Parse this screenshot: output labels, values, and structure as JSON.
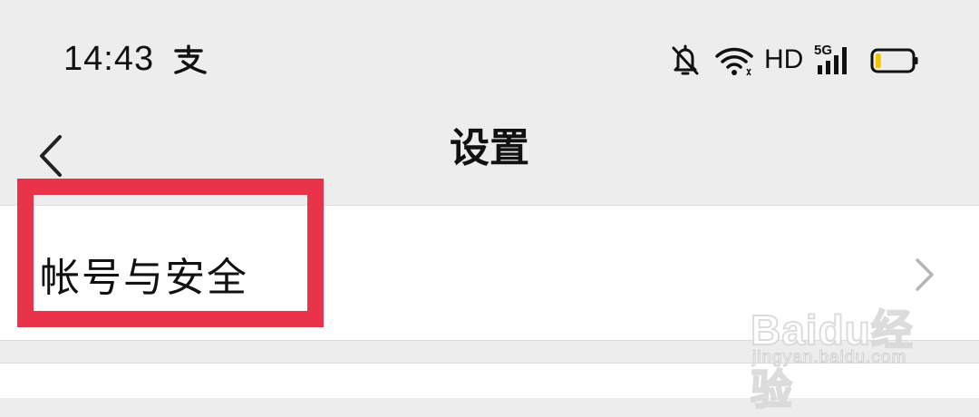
{
  "status_bar": {
    "time": "14:43",
    "app_icon": "alipay-icon",
    "icons": [
      "bell-off-icon",
      "wifi-icon",
      "signal-5g-icon",
      "battery-icon"
    ],
    "hd_label": "HD",
    "network_label": "5G",
    "battery_level": 0.15,
    "battery_color": "#f5c400"
  },
  "nav": {
    "back_icon": "chevron-left-icon",
    "title": "设置"
  },
  "list": {
    "items": [
      {
        "label": "帐号与安全",
        "icon": "chevron-right-icon"
      }
    ]
  },
  "highlight": {
    "color": "#e8334a",
    "target": "帐号与安全"
  },
  "watermark": {
    "logo": "Baidu经验",
    "url": "jingyan.baidu.com"
  },
  "colors": {
    "background": "#ededed",
    "row_background": "#ffffff",
    "divider": "#dcdcdc"
  }
}
